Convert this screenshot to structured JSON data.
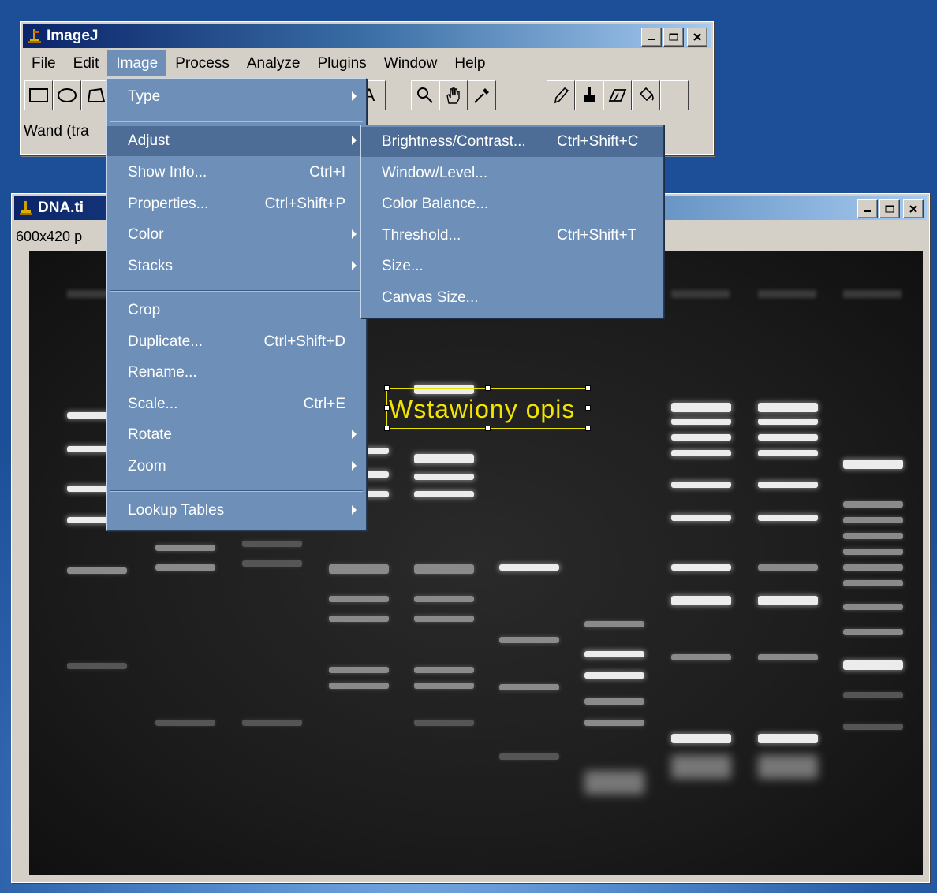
{
  "main_window": {
    "title": "ImageJ",
    "menus": [
      "File",
      "Edit",
      "Image",
      "Process",
      "Analyze",
      "Plugins",
      "Window",
      "Help"
    ],
    "active_menu": "Image",
    "status": "Wand (tra"
  },
  "tools": [
    "rectangle-icon",
    "oval-icon",
    "polygon-icon",
    "text-icon",
    "magnifier-icon",
    "hand-icon",
    "dropper-icon",
    "pencil-icon",
    "brush-icon",
    "eraser-icon",
    "flood-fill-icon"
  ],
  "image_window": {
    "title": "DNA.ti",
    "info": "600x420 p",
    "overlay_text": "Wstawiony opis"
  },
  "image_menu": {
    "items": [
      {
        "label": "Type",
        "shortcut": "",
        "submenu": true
      },
      {
        "label": "Adjust",
        "shortcut": "",
        "submenu": true
      },
      {
        "label": "Show Info...",
        "shortcut": "Ctrl+I",
        "submenu": false
      },
      {
        "label": "Properties...",
        "shortcut": "Ctrl+Shift+P",
        "submenu": false
      },
      {
        "label": "Color",
        "shortcut": "",
        "submenu": true
      },
      {
        "label": "Stacks",
        "shortcut": "",
        "submenu": true
      },
      {
        "label": "Crop",
        "shortcut": "",
        "submenu": false
      },
      {
        "label": "Duplicate...",
        "shortcut": "Ctrl+Shift+D",
        "submenu": false
      },
      {
        "label": "Rename...",
        "shortcut": "",
        "submenu": false
      },
      {
        "label": "Scale...",
        "shortcut": "Ctrl+E",
        "submenu": false
      },
      {
        "label": "Rotate",
        "shortcut": "",
        "submenu": true
      },
      {
        "label": "Zoom",
        "shortcut": "",
        "submenu": true
      },
      {
        "label": "Lookup Tables",
        "shortcut": "",
        "submenu": true
      }
    ]
  },
  "adjust_menu": {
    "items": [
      {
        "label": "Brightness/Contrast...",
        "shortcut": "Ctrl+Shift+C"
      },
      {
        "label": "Window/Level...",
        "shortcut": ""
      },
      {
        "label": "Color Balance...",
        "shortcut": ""
      },
      {
        "label": "Threshold...",
        "shortcut": "Ctrl+Shift+T"
      },
      {
        "label": "Size...",
        "shortcut": ""
      },
      {
        "label": "Canvas Size...",
        "shortcut": ""
      }
    ]
  },
  "colors": {
    "menu_bg": "#6d8fb8",
    "menu_selected": "#4e6d96",
    "overlay_text": "#f0e400"
  }
}
